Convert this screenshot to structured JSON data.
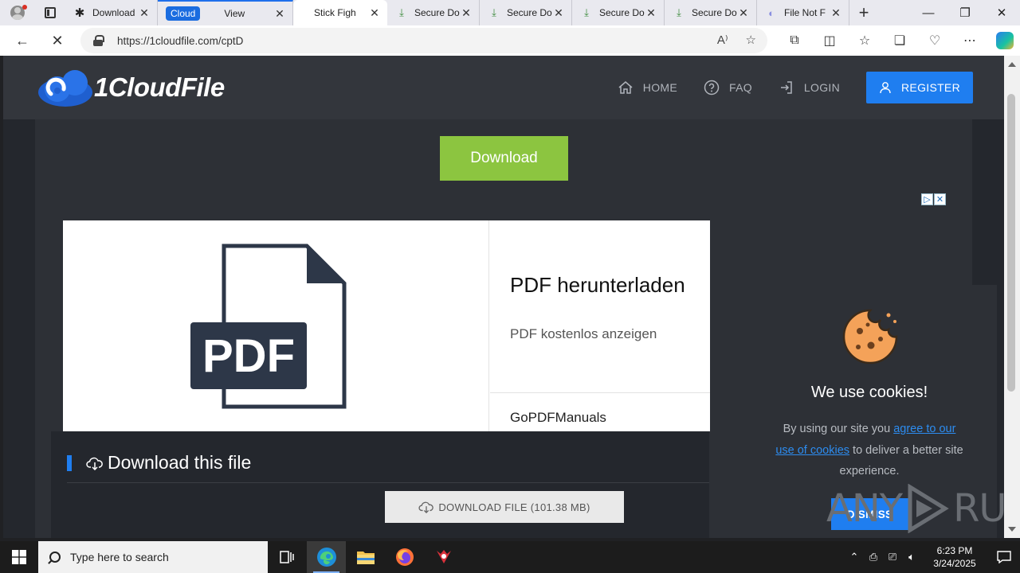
{
  "browser": {
    "tabs": [
      {
        "title": "Download",
        "close": "✕"
      },
      {
        "group": "Cloud",
        "title": "View",
        "close": "✕"
      },
      {
        "title": "Stick Figh",
        "close": "✕"
      },
      {
        "title": "Secure Do",
        "close": "✕"
      },
      {
        "title": "Secure Do",
        "close": "✕"
      },
      {
        "title": "Secure Do",
        "close": "✕"
      },
      {
        "title": "Secure Do",
        "close": "✕"
      },
      {
        "title": "File Not F",
        "close": "✕"
      }
    ],
    "new_tab": "+",
    "url": "https://1cloudfile.com/cptD",
    "window_controls": {
      "minimize": "—",
      "maximize": "❐",
      "close": "✕"
    }
  },
  "site": {
    "logo_text": "1CloudFile",
    "nav": {
      "home": "HOME",
      "faq": "FAQ",
      "login": "LOGIN",
      "register": "REGISTER"
    },
    "download_top": "Download",
    "ad": {
      "pdf_label": "PDF",
      "title": "PDF herunterladen",
      "subtitle": "PDF kostenlos anzeigen",
      "brand": "GoPDFManuals",
      "choices": [
        "▷",
        "✕"
      ]
    },
    "download_section": {
      "heading": "Download this file",
      "button": "DOWNLOAD FILE (101.38 MB)"
    },
    "cookie": {
      "title": "We use cookies!",
      "msg_pre": "By using our site you ",
      "msg_link": "agree to our use of cookies",
      "msg_post": " to deliver a better site experience.",
      "dismiss": "DISMISS"
    },
    "watermark": {
      "left": "ANY",
      "right": "RUN"
    }
  },
  "taskbar": {
    "search_placeholder": "Type here to search",
    "time": "6:23 PM",
    "date": "3/24/2025"
  }
}
